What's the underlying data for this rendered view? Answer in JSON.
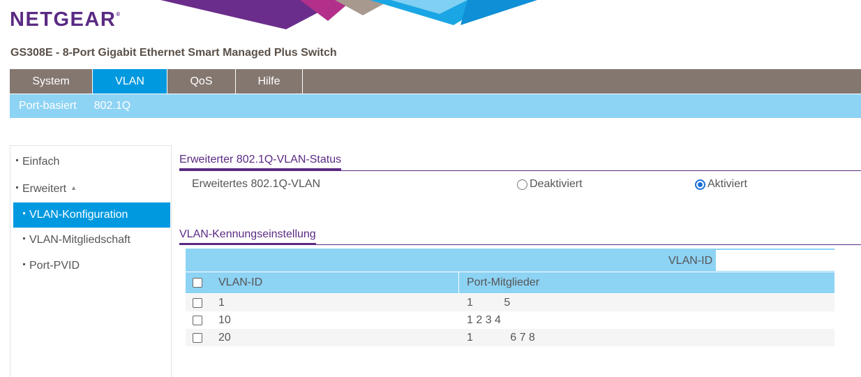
{
  "header": {
    "logo": "NETGEAR",
    "logo_mark": "®",
    "product_title": "GS308E - 8-Port Gigabit Ethernet Smart Managed Plus Switch"
  },
  "colors": {
    "brand_purple": "#5a2a83",
    "nav_gray": "#847770",
    "accent_blue": "#0099e0",
    "light_blue": "#8dd3f4"
  },
  "main_nav": {
    "tabs": [
      {
        "label": "System",
        "active": false
      },
      {
        "label": "VLAN",
        "active": true
      },
      {
        "label": "QoS",
        "active": false
      },
      {
        "label": "Hilfe",
        "active": false
      }
    ]
  },
  "sub_nav": {
    "items": [
      {
        "label": "Port-basiert"
      },
      {
        "label": "802.1Q"
      }
    ]
  },
  "sidebar": {
    "items": [
      {
        "label": "Einfach"
      },
      {
        "label": "Erweitert",
        "icon": "caret-up-icon"
      },
      {
        "label": "VLAN-Konfiguration",
        "active": true
      },
      {
        "label": "VLAN-Mitgliedschaft"
      },
      {
        "label": "Port-PVID"
      }
    ]
  },
  "status_section": {
    "title": "Erweiterter 802.1Q-VLAN-Status",
    "label": "Erweitertes 802.1Q-VLAN",
    "options": [
      {
        "label": "Deaktiviert",
        "selected": false
      },
      {
        "label": "Aktiviert",
        "selected": true
      }
    ]
  },
  "id_section": {
    "title": "VLAN-Kennungseinstellung",
    "vlan_id_label": "VLAN-ID",
    "vlan_id_value": "",
    "columns": [
      "VLAN-ID",
      "Port-Mitglieder"
    ],
    "rows": [
      {
        "vlan_id": "1",
        "ports": "1          5"
      },
      {
        "vlan_id": "10",
        "ports": "1 2 3 4"
      },
      {
        "vlan_id": "20",
        "ports": "1            6 7 8"
      }
    ]
  }
}
